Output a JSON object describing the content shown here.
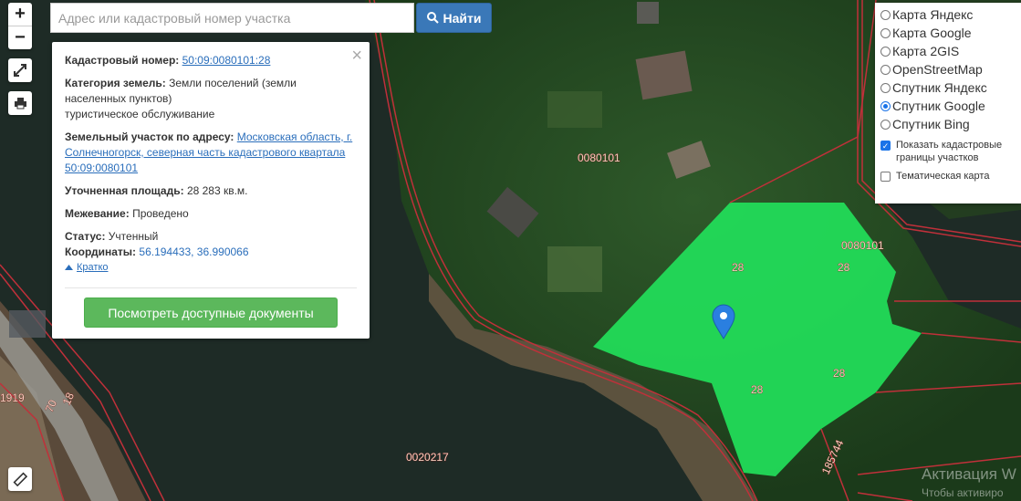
{
  "search": {
    "placeholder": "Адрес или кадастровый номер участка",
    "button_label": "Найти"
  },
  "zoom": {
    "in_label": "+",
    "out_label": "−"
  },
  "info": {
    "cadastral_number_label": "Кадастровый номер:",
    "cadastral_number": "50:09:0080101:28",
    "category_label": "Категория земель:",
    "category_value": "Земли поселений (земли населенных пунктов)",
    "usage": "туристическое обслуживание",
    "address_label": "Земельный участок по адресу:",
    "address_value": "Московская область, г. Солнечногорск, северная часть кадастрового квартала 50:09:0080101",
    "area_label": "Уточненная площадь:",
    "area_value": "28 283 кв.м.",
    "survey_label": "Межевание:",
    "survey_value": "Проведено",
    "status_label": "Статус:",
    "status_value": "Учтенный",
    "coords_label": "Координаты:",
    "coords_value": "56.194433, 36.990066",
    "toggle_label": "Кратко",
    "docs_button": "Посмотреть доступные документы"
  },
  "layers": {
    "options": [
      "Карта Яндекс",
      "Карта Google",
      "Карта 2GIS",
      "OpenStreetMap",
      "Спутник Яндекс",
      "Спутник Google",
      "Спутник Bing"
    ],
    "selected": "Спутник Google",
    "checkboxes": [
      {
        "label": "Показать кадастровые границы участков",
        "checked": true
      },
      {
        "label": "Тематическая карта",
        "checked": false
      }
    ]
  },
  "map_labels": {
    "quarter_top": "0080101",
    "quarter_right": "0080101",
    "quarter_bottom": "0020217",
    "parcel_28": "28",
    "parcel_1919": "1919",
    "parcel_70": "70",
    "parcel_18": "18",
    "parcel_185744": "185744"
  },
  "watermark": {
    "line1": "Активация W",
    "line2": "Чтобы активиро"
  },
  "colors": {
    "parcel_fill": "#22e05a",
    "boundary": "#c0303a",
    "accent_button": "#3a78b8",
    "docs_button": "#5cb85c"
  }
}
